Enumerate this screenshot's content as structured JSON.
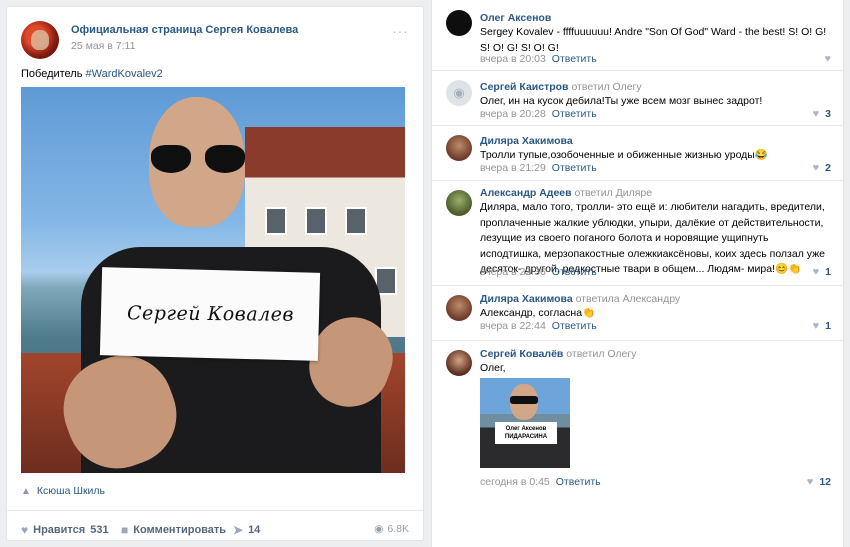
{
  "post": {
    "author": "Официальная страница Сергея Ковалева",
    "date": "25 мая в 7:11",
    "more": "···",
    "text_prefix": "Победитель ",
    "hashtag": "#WardKovalev2",
    "sign_text": "Сергей Ковалев",
    "tagged_person": "Ксюша Шкиль",
    "actions": {
      "like_label": "Нравится",
      "like_count": "531",
      "comment_label": "Комментировать",
      "share_count": "14",
      "views": "6.8K"
    }
  },
  "comments": [
    {
      "author": "Олег Аксенов",
      "reply_to": "",
      "text": "Sergey Kovalev - ffffuuuuuu! Andre \"Son Of God\" Ward - the best! S! O! G! S! O! G! S! O! G!",
      "time": "вчера в 20:03",
      "reply_label": "Ответить",
      "likes": ""
    },
    {
      "author": "Сергей Каистров",
      "reply_to": "ответил Олегу",
      "text": "Олег, ин на кусок дебила!Ты уже всем мозг вынес задрот!",
      "time": "вчера в 20:28",
      "reply_label": "Ответить",
      "likes": "3"
    },
    {
      "author": "Диляра Хакимова",
      "reply_to": "",
      "text": "Тролли тупые,озобоченные и обиженные жизнью уроды😂",
      "time": "вчера в 21:29",
      "reply_label": "Ответить",
      "likes": "2"
    },
    {
      "author": "Александр Адеев",
      "reply_to": "ответил Диляре",
      "text": "Диляра, мало того, тролли- это ещё и: любители нагадить, вредители, проплаченные жалкие ублюдки, упыри, далёкие от действительности, лезущие из своего поганого болота и норовящие ущипнуть исподтишка, мерзопакостные олежкиаксёновы, коих здесь ползал уже десяток- другой, редкостные твари в общем... Людям- мира!😊👏",
      "time": "вчера в 22:36",
      "reply_label": "Ответить",
      "likes": "1"
    },
    {
      "author": "Диляра Хакимова",
      "reply_to": "ответила Александру",
      "text": "Александр, согласна👏",
      "time": "вчера в 22:44",
      "reply_label": "Ответить",
      "likes": "1"
    },
    {
      "author": "Сергей Ковалёв",
      "reply_to": "ответил Олегу",
      "text": "Олег,",
      "time": "сегодня в 0:45",
      "reply_label": "Ответить",
      "likes": "12",
      "image_caption_line1": "Олег Аксенов",
      "image_caption_line2": "ПИДАРАСИНА"
    }
  ],
  "icons": {
    "heart": "heart-icon",
    "comment": "comment-icon",
    "share": "share-icon",
    "eye": "eye-icon",
    "person": "person-icon",
    "camera": "camera-icon"
  }
}
